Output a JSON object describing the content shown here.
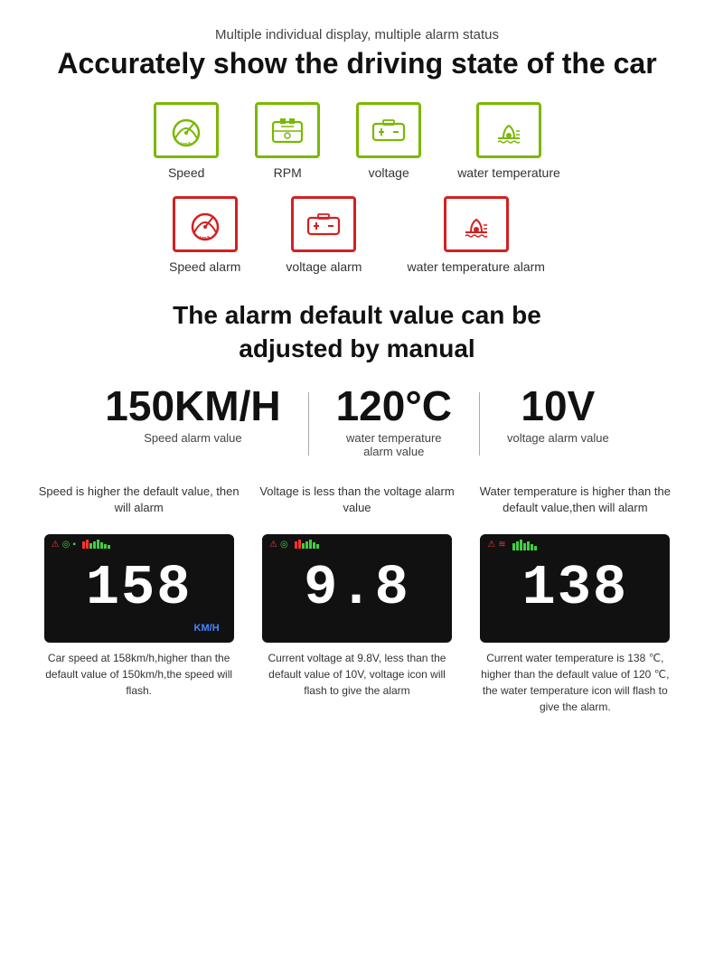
{
  "header": {
    "sub": "Multiple individual display, multiple alarm status",
    "main": "Accurately show the driving state of the car"
  },
  "green_icons": [
    {
      "id": "speed",
      "label": "Speed"
    },
    {
      "id": "rpm",
      "label": "RPM"
    },
    {
      "id": "voltage",
      "label": "voltage"
    },
    {
      "id": "water_temp",
      "label": "water temperature"
    }
  ],
  "red_icons": [
    {
      "id": "speed_alarm",
      "label": "Speed alarm"
    },
    {
      "id": "voltage_alarm",
      "label": "voltage alarm"
    },
    {
      "id": "water_temp_alarm",
      "label": "water temperature alarm"
    }
  ],
  "alarm_default": {
    "line1": "The alarm default value can be",
    "line2": "adjusted by manual"
  },
  "values": [
    {
      "num": "150KM/H",
      "label": "Speed alarm value"
    },
    {
      "num": "120°C",
      "label": "water temperature\nalarm value"
    },
    {
      "num": "10V",
      "label": "voltage alarm value"
    }
  ],
  "examples": [
    {
      "title": "Speed is higher the default value, then will alarm",
      "display_num": "158",
      "unit": "KM/H",
      "caption": "Car speed at 158km/h,higher than the default value of 150km/h,the speed will flash."
    },
    {
      "title": "Voltage is less than the voltage alarm value",
      "display_num": "9.8",
      "unit": "",
      "caption": "Current voltage at 9.8V, less than the default value of 10V, voltage icon will flash to give the alarm"
    },
    {
      "title": "Water temperature is higher than the default value,then will alarm",
      "display_num": "138",
      "unit": "",
      "caption": "Current water temperature is 138 ℃, higher than the default value of 120 ℃, the water temperature icon will flash to give the alarm."
    }
  ]
}
